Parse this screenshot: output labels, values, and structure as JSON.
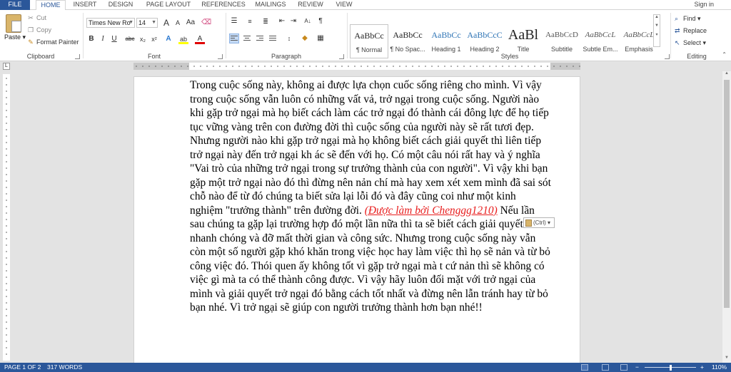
{
  "tabs": {
    "file": "FILE",
    "home": "HOME",
    "insert": "INSERT",
    "design": "DESIGN",
    "page_layout": "PAGE LAYOUT",
    "references": "REFERENCES",
    "mailings": "MAILINGS",
    "review": "REVIEW",
    "view": "VIEW",
    "active": "HOME"
  },
  "account": {
    "signin": "Sign in"
  },
  "clipboard": {
    "paste": "Paste",
    "cut": "Cut",
    "copy": "Copy",
    "format_painter": "Format Painter",
    "label": "Clipboard"
  },
  "font": {
    "family": "Times New Ro",
    "size": "14",
    "grow": "A",
    "shrink": "A",
    "change_case": "Aa",
    "bold": "B",
    "italic": "I",
    "underline": "U",
    "strike": "abc",
    "subscript": "x₂",
    "superscript": "x²",
    "text_effects": "A",
    "highlight": "ab",
    "font_color": "A",
    "label": "Font"
  },
  "paragraph": {
    "label": "Paragraph",
    "sort": "A↓",
    "show_marks": "¶"
  },
  "styles": {
    "label": "Styles",
    "items": [
      {
        "preview": "AaBbCc",
        "name": "¶ Normal"
      },
      {
        "preview": "AaBbCc",
        "name": "¶ No Spac..."
      },
      {
        "preview": "AaBbCc",
        "name": "Heading 1"
      },
      {
        "preview": "AaBbCcC",
        "name": "Heading 2"
      },
      {
        "preview": "AaBl",
        "name": "Title"
      },
      {
        "preview": "AaBbCcD",
        "name": "Subtitle"
      },
      {
        "preview": "AaBbCcL",
        "name": "Subtle Em..."
      },
      {
        "preview": "AaBbCcL",
        "name": "Emphasis"
      }
    ]
  },
  "editing": {
    "find": "Find",
    "replace": "Replace",
    "select": "Select",
    "label": "Editing"
  },
  "document": {
    "part1": "Trong cuộc sống này, không ai được lựa chọn cuốc sống riêng cho mình. Vì vậy trong cuộc sống vẫn luôn có những vất vả, trở ngại trong cuộc sống. Người nào khi gặp trở ngại mà họ biết cách làm các trở ngại đó thành cái đông lực để họ tiếp tục vững vàng trên con đường đời thì cuộc sống của người này sẽ rất tươi đẹp. Nhưng người nào khi gặp trở ngại mà họ không biết cách giải quyết thì liên tiếp trở ngại này đến trở ngại kh ác sẽ đến với họ. Có một câu nói rất hay và ý nghĩa \"Vai trò của những trở ngại trong sự trưởng thành của con người\". Vì vậy khi bạn gặp một trở ngại nào đó thì đừng nên nản chí mà hay xem xét xem mình đã sai sót chỗ nào để từ đó chúng ta biết sửa lại lỗi đó và đây cũng coi như một kinh nghiệm \"trưởng thành\" trên đường đời. ",
    "credit": "(Được làm bởi Chenggg1210)",
    "part2": " Nếu lần sau chúng ta gặp lại trường hợp đó một lần nữa thì ta sẽ biết cách giải quyết nó nhanh chóng và đỡ mất thời gian và công sức. Nhưng trong cuộc sống này vẫn còn một số người gặp khó khăn trong việc học hay làm việc thì họ sẽ nản và từ bỏ công việc đó. Thói quen ấy không tốt vì gặp trở ngại mà t cứ nản thì sẽ không có việc gì mà ta có thể thành công được. Vì vậy hãy luôn đối mặt với trở ngại của mình và giải quyết trở ngại đó bằng cách tốt nhất và đừng nên lẫn tránh hay từ bỏ bạn nhé. Vì trở ngại sẽ giúp con người trưởng thành hơn bạn nhé!!",
    "paste_options": "(Ctrl)"
  },
  "colors": {
    "accent": "#2b579a",
    "credit_text": "#e81c1c"
  },
  "status": {
    "page": "PAGE 1 OF 2",
    "words": "317 WORDS",
    "zoom": "110%",
    "zoom_value": 110
  }
}
